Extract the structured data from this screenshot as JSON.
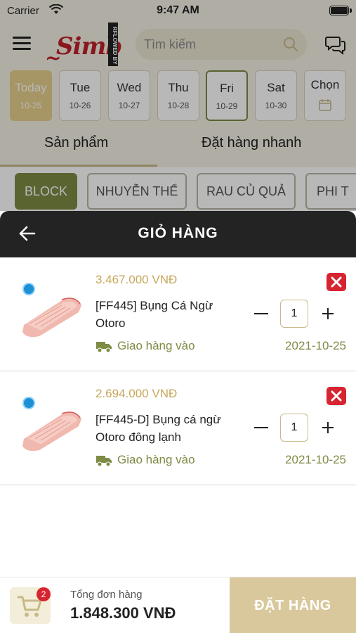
{
  "status_bar": {
    "carrier": "Carrier",
    "time": "9:47 AM"
  },
  "header": {
    "logo_text": "Simb",
    "logo_tag": "RFLOWED BY",
    "search": {
      "placeholder": "Tìm kiếm",
      "value": ""
    }
  },
  "dates": [
    {
      "day": "Today",
      "num": "10-25",
      "state": "today"
    },
    {
      "day": "Tue",
      "num": "10-26",
      "state": ""
    },
    {
      "day": "Wed",
      "num": "10-27",
      "state": ""
    },
    {
      "day": "Thu",
      "num": "10-28",
      "state": ""
    },
    {
      "day": "Fri",
      "num": "10-29",
      "state": "selected"
    },
    {
      "day": "Sat",
      "num": "10-30",
      "state": ""
    },
    {
      "day": "Chọn",
      "num": "",
      "state": "picker"
    }
  ],
  "tabs": {
    "products": "Sản phẩm",
    "quick_order": "Đặt hàng nhanh"
  },
  "categories": [
    "BLOCK",
    "NHUYỄN THỂ",
    "RAU CỦ QUẢ",
    "PHI T"
  ],
  "cart": {
    "title": "GIỎ HÀNG",
    "items": [
      {
        "price": "3.467.000 VNĐ",
        "name": "[FF445] Bụng Cá Ngừ Otoro",
        "delivery_label": "Giao hàng vào",
        "delivery_date": "2021-10-25",
        "quantity": "1"
      },
      {
        "price": "2.694.000 VNĐ",
        "name": "[FF445-D] Bụng cá ngừ Otoro đông lạnh",
        "delivery_label": "Giao hàng vào",
        "delivery_date": "2021-10-25",
        "quantity": "1"
      }
    ]
  },
  "footer": {
    "cart_count": "2",
    "total_label": "Tổng đơn hàng",
    "total_value": "1.848.300 VNĐ",
    "order_button": "ĐẶT HÀNG"
  },
  "colors": {
    "accent_gold": "#c8a65a",
    "olive": "#7d8b45",
    "dark_header": "#232323",
    "remove_red": "#d62430",
    "order_button": "#d9c89b"
  }
}
